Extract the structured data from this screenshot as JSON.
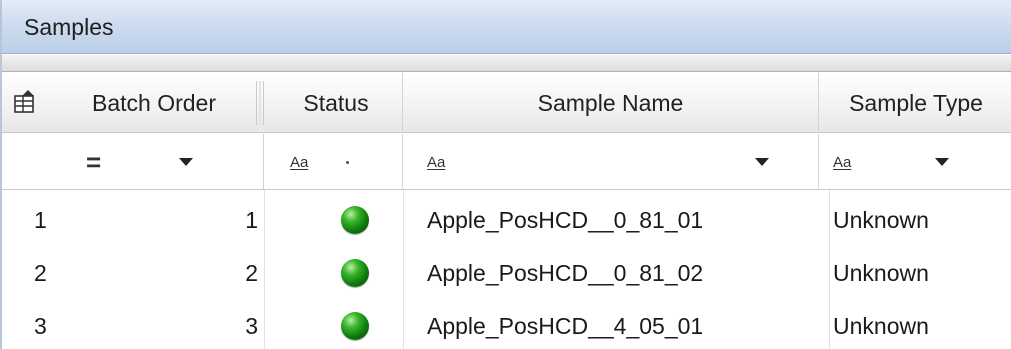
{
  "panel": {
    "title": "Samples"
  },
  "columns": {
    "batch_order": "Batch Order",
    "status": "Status",
    "sample_name": "Sample Name",
    "sample_type": "Sample Type"
  },
  "filters": {
    "batch_order_operator": "=",
    "status_text_filter": "Aa",
    "sample_name_text_filter": "Aa",
    "sample_type_text_filter": "Aa"
  },
  "rows": [
    {
      "index": "1",
      "batch_order": "1",
      "status": "ok-green",
      "sample_name": "Apple_PosHCD__0_81_01",
      "sample_type": "Unknown"
    },
    {
      "index": "2",
      "batch_order": "2",
      "status": "ok-green",
      "sample_name": "Apple_PosHCD__0_81_02",
      "sample_type": "Unknown"
    },
    {
      "index": "3",
      "batch_order": "3",
      "status": "ok-green",
      "sample_name": "Apple_PosHCD__4_05_01",
      "sample_type": "Unknown"
    }
  ],
  "icons": {
    "column_chooser": "column-chooser-icon",
    "status_indicator": "green-ball-icon"
  },
  "colors": {
    "title_bar": "#cddcef",
    "status_ok": "#39b52b"
  }
}
